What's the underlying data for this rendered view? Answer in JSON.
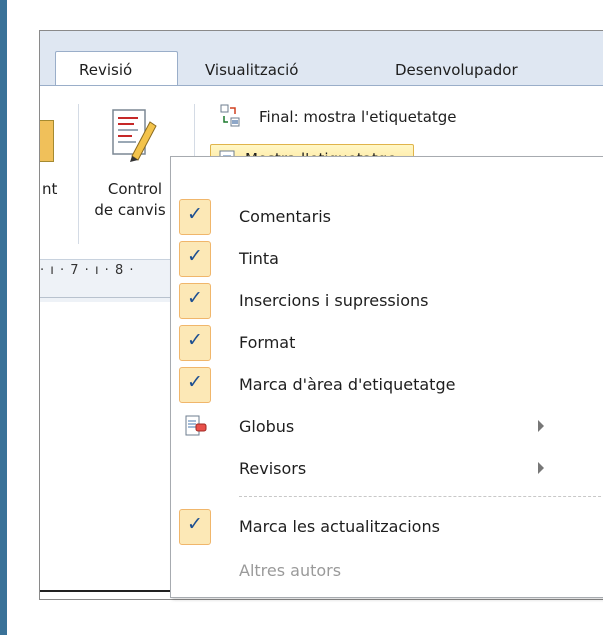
{
  "tabs": [
    "Revisió",
    "Visualització",
    "Desenvolupador"
  ],
  "ribbon": {
    "partial_label": "nt",
    "control_label_1": "Control",
    "control_label_2": "de canvis"
  },
  "final_view": {
    "label": "Final: mostra l'etiquetatge"
  },
  "mostra_button": {
    "label": "Mostra l'etiquetatge"
  },
  "ruler": {
    "text": "· ı · 7 · ı · 8 ·"
  },
  "menu": {
    "items": [
      {
        "label": "Comentaris",
        "checked": true
      },
      {
        "label": "Tinta",
        "checked": true
      },
      {
        "label": "Insercions i supressions",
        "checked": true
      },
      {
        "label": "Format",
        "checked": true
      },
      {
        "label": "Marca d'àrea d'etiquetatge",
        "checked": true
      },
      {
        "label": "Globus",
        "icon": "balloon-icon",
        "submenu": true
      },
      {
        "label": "Revisors",
        "submenu": true
      },
      {
        "label": "Marca les actualitzacions",
        "checked": true
      },
      {
        "label": "Altres autors",
        "disabled": true
      }
    ],
    "check_glyph": "✓"
  },
  "colors": {
    "left_bar": "#3a7298",
    "menu_highlight": "#fce8b6",
    "button_highlight": "#ffe18a",
    "disabled_text": "#9a9a9a"
  }
}
